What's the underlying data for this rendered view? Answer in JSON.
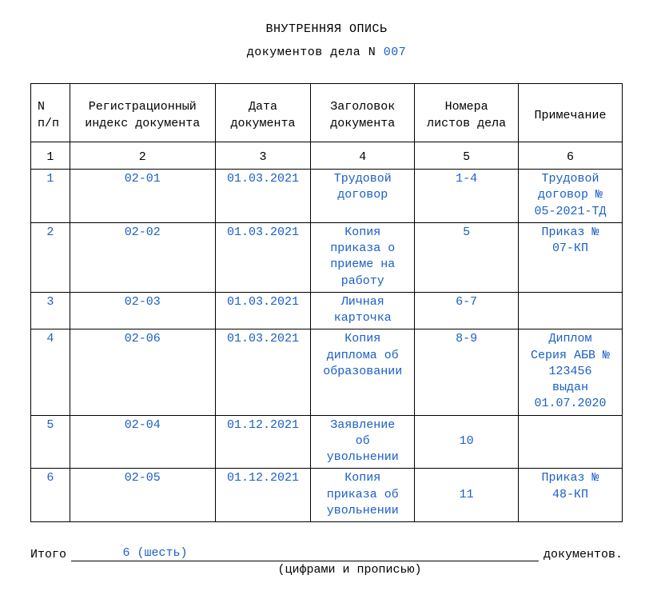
{
  "header": {
    "title": "ВНУТРЕННЯЯ ОПИСЬ",
    "subtitle_prefix": "документов дела N ",
    "case_number": "007"
  },
  "columns": {
    "c1": "N\nп/п",
    "c2": "Регистрационный\nиндекс документа",
    "c3": "Дата\nдокумента",
    "c4": "Заголовок\nдокумента",
    "c5": "Номера\nлистов дела",
    "c6": "Примечание",
    "n1": "1",
    "n2": "2",
    "n3": "3",
    "n4": "4",
    "n5": "5",
    "n6": "6"
  },
  "rows": [
    {
      "n": "1",
      "reg": "02-01",
      "date": "01.03.2021",
      "title": "Трудовой\nдоговор",
      "pages": "1-4",
      "note": "Трудовой\nдоговор №\n05-2021-ТД",
      "pcenter": false
    },
    {
      "n": "2",
      "reg": "02-02",
      "date": "01.03.2021",
      "title": "Копия\nприказа о\nприеме на\nработу",
      "pages": "5",
      "note": "Приказ №\n07-КП",
      "pcenter": false
    },
    {
      "n": "3",
      "reg": "02-03",
      "date": "01.03.2021",
      "title": "Личная\nкарточка",
      "pages": "6-7",
      "note": "",
      "pcenter": false
    },
    {
      "n": "4",
      "reg": "02-06",
      "date": "01.03.2021",
      "title": "Копия\nдиплома об\nобразовании",
      "pages": "8-9",
      "note": "Диплом\nСерия АБВ №\n123456\nвыдан\n01.07.2020",
      "pcenter": false
    },
    {
      "n": "5",
      "reg": "02-04",
      "date": "01.12.2021",
      "title": "Заявление\nоб\nувольнении",
      "pages": "10",
      "note": "",
      "pcenter": true
    },
    {
      "n": "6",
      "reg": "02-05",
      "date": "01.12.2021",
      "title": "Копия\nприказа об\nувольнении",
      "pages": "11",
      "note": "Приказ №\n48-КП",
      "pcenter": true
    }
  ],
  "footer": {
    "total_label": "Итого",
    "total_value": "6 (шесть)",
    "suffix": "документов.",
    "caption": "(цифрами и прописью)"
  },
  "chart_data": {
    "type": "table",
    "title": "ВНУТРЕННЯЯ ОПИСЬ документов дела N 007",
    "columns": [
      "N п/п",
      "Регистрационный индекс документа",
      "Дата документа",
      "Заголовок документа",
      "Номера листов дела",
      "Примечание"
    ],
    "rows": [
      [
        "1",
        "02-01",
        "01.03.2021",
        "Трудовой договор",
        "1-4",
        "Трудовой договор № 05-2021-ТД"
      ],
      [
        "2",
        "02-02",
        "01.03.2021",
        "Копия приказа о приеме на работу",
        "5",
        "Приказ № 07-КП"
      ],
      [
        "3",
        "02-03",
        "01.03.2021",
        "Личная карточка",
        "6-7",
        ""
      ],
      [
        "4",
        "02-06",
        "01.03.2021",
        "Копия диплома об образовании",
        "8-9",
        "Диплом Серия АБВ № 123456 выдан 01.07.2020"
      ],
      [
        "5",
        "02-04",
        "01.12.2021",
        "Заявление об увольнении",
        "10",
        ""
      ],
      [
        "6",
        "02-05",
        "01.12.2021",
        "Копия приказа об увольнении",
        "11",
        "Приказ № 48-КП"
      ]
    ],
    "total_documents": 6
  }
}
